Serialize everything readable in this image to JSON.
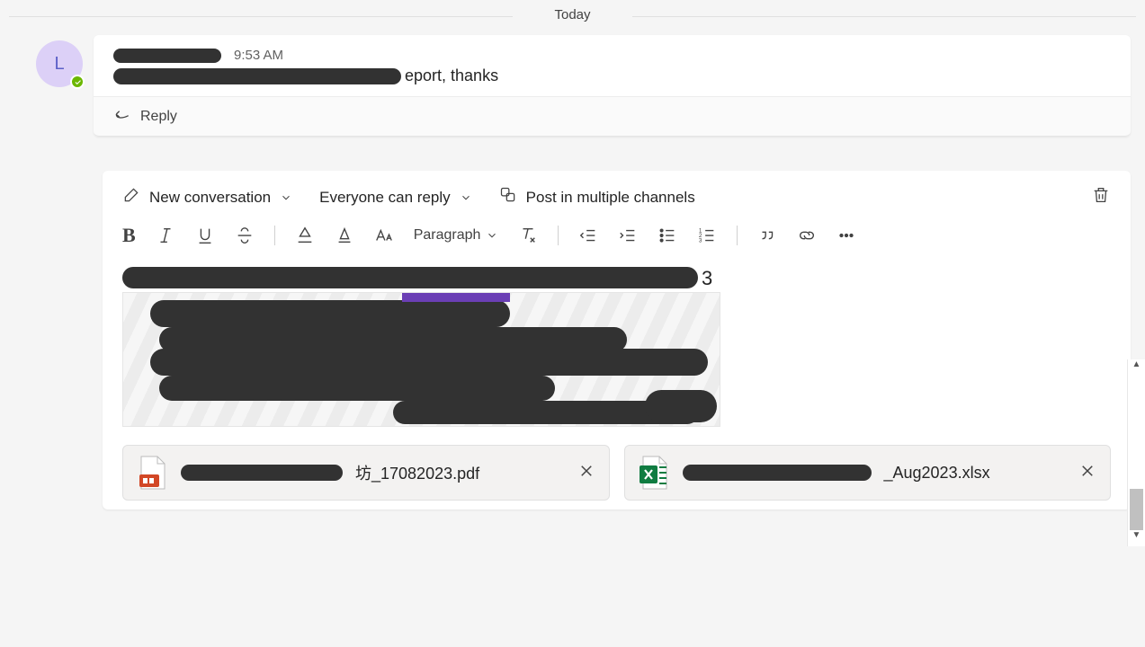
{
  "date_separator": "Today",
  "message": {
    "avatar_initial": "L",
    "sender": "[redacted]",
    "time": "9:53 AM",
    "visible_text_suffix": "eport, thanks",
    "full_text_redacted": true
  },
  "reply_label": "Reply",
  "composer": {
    "new_conversation": "New conversation",
    "reply_scope": "Everyone can reply",
    "post_multi": "Post in multiple channels",
    "paragraph_label": "Paragraph",
    "body_visible_trailing": "3",
    "body_redacted": true
  },
  "attachments": [
    {
      "name_suffix": "坊_17082023.pdf",
      "type": "pdf"
    },
    {
      "name_suffix": "_Aug2023.xlsx",
      "type": "xlsx"
    }
  ]
}
